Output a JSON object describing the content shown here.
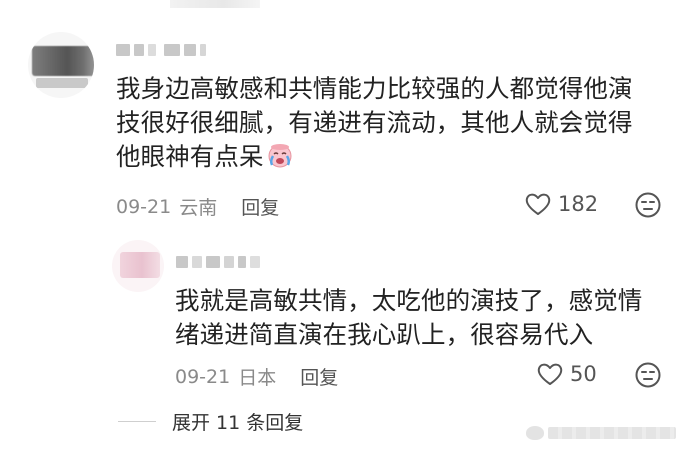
{
  "comments": [
    {
      "text": "我身边高敏感和共情能力比较强的人都觉得他演\n技很好很细腻，有递进有流动，其他人就会觉得\n他眼神有点呆",
      "emoji": "crying-face-emoji",
      "date": "09-21",
      "location": "云南",
      "reply_label": "回复",
      "likes": "182"
    },
    {
      "text": "我就是高敏共情，太吃他的演技了，感觉情\n绪递进简直演在我心趴上，很容易代入",
      "date": "09-21",
      "location": "日本",
      "reply_label": "回复",
      "likes": "50"
    }
  ],
  "expand_label": "展开 11 条回复",
  "icons": {
    "like": "heart-outline-icon",
    "dislike": "dislike-face-icon"
  },
  "colors": {
    "text": "#222222",
    "meta": "#8a8a8a",
    "icon": "#555555"
  }
}
